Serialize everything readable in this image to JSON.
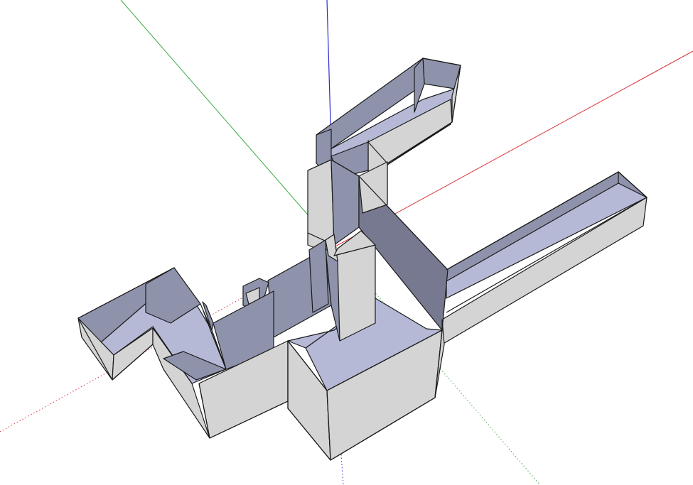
{
  "scene": {
    "background": "#ffffff",
    "axis_colors": {
      "red": "#d9363e",
      "green": "#3aa845",
      "blue": "#2a2ad0"
    },
    "face_colors": {
      "outer_wall": "#d4d4d4",
      "inner_wall": "#8e93ab",
      "inner_wall_dark": "#76798f",
      "floor": "#b5b9d6",
      "edge": "#1a1a1a"
    }
  }
}
